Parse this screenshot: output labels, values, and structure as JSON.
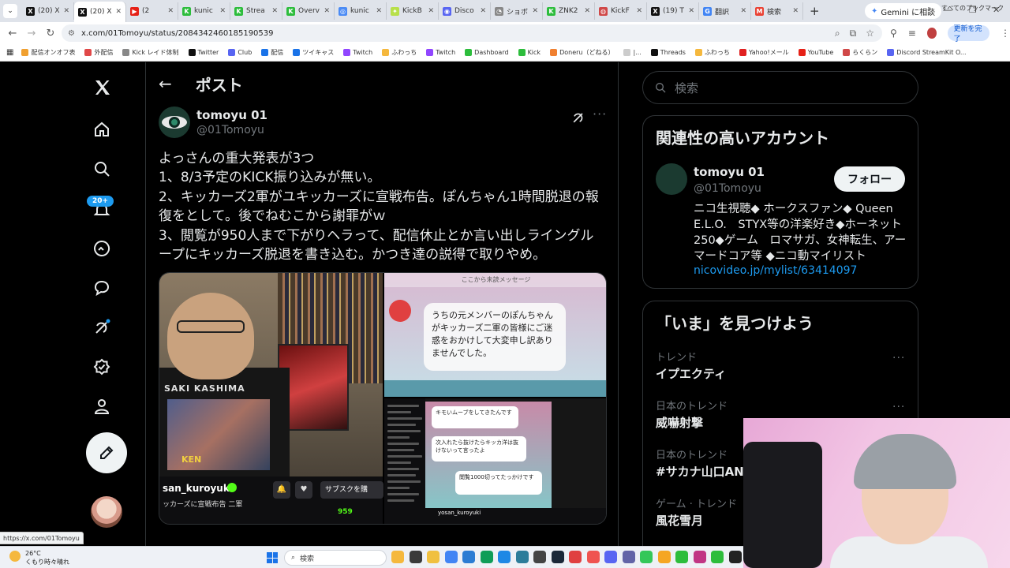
{
  "browser": {
    "tabs": [
      {
        "label": "(20) X",
        "color": "#111111",
        "glyph": "X"
      },
      {
        "label": "(20) X",
        "color": "#111111",
        "glyph": "X",
        "active": true
      },
      {
        "label": "(2",
        "color": "#e62117",
        "glyph": "▶"
      },
      {
        "label": "kunic",
        "color": "#2dbd3c",
        "glyph": "K"
      },
      {
        "label": "Strea",
        "color": "#2dbd3c",
        "glyph": "K"
      },
      {
        "label": "Overv",
        "color": "#2dbd3c",
        "glyph": "K"
      },
      {
        "label": "kunic",
        "color": "#4b8bf5",
        "glyph": "◎"
      },
      {
        "label": "KickB",
        "color": "#b8e04a",
        "glyph": "✦"
      },
      {
        "label": "Disco",
        "color": "#5865f2",
        "glyph": "◉"
      },
      {
        "label": "ショボ",
        "color": "#888888",
        "glyph": "◔"
      },
      {
        "label": "ZNK2",
        "color": "#2dbd3c",
        "glyph": "K"
      },
      {
        "label": "KickF",
        "color": "#d04848",
        "glyph": "◍"
      },
      {
        "label": "(19) T",
        "color": "#111111",
        "glyph": "X"
      },
      {
        "label": "翻訳",
        "color": "#4285f4",
        "glyph": "G"
      },
      {
        "label": "検索",
        "color": "#ea4335",
        "glyph": "M"
      }
    ],
    "gemini_label": "Gemini に相談",
    "url": "x.com/01Tomoyu/status/2084342460185190539",
    "update_label": "更新を完了",
    "bookmarks": [
      {
        "label": "配信オンオフ表",
        "color": "#f0a030"
      },
      {
        "label": "外配信",
        "color": "#e04848"
      },
      {
        "label": "Kick レイド体制",
        "color": "#888888"
      },
      {
        "label": "Twitter",
        "color": "#111111"
      },
      {
        "label": "Club",
        "color": "#5865f2"
      },
      {
        "label": "配信",
        "color": "#1a73e8"
      },
      {
        "label": "ツイキャス",
        "color": "#1a73e8"
      },
      {
        "label": "Twitch",
        "color": "#9146ff"
      },
      {
        "label": "ふわっち",
        "color": "#f5b83d"
      },
      {
        "label": "Twitch",
        "color": "#9146ff"
      },
      {
        "label": "Dashboard",
        "color": "#2dbd3c"
      },
      {
        "label": "Kick",
        "color": "#2dbd3c"
      },
      {
        "label": "Doneru（どねる）",
        "color": "#f08030"
      },
      {
        "label": "|...",
        "color": "#cccccc"
      },
      {
        "label": "Threads",
        "color": "#111111"
      },
      {
        "label": "ふわっち",
        "color": "#f5b83d"
      },
      {
        "label": "Yahoo!メール",
        "color": "#e02020"
      },
      {
        "label": "YouTube",
        "color": "#e62117"
      },
      {
        "label": "らくらン",
        "color": "#d04848"
      },
      {
        "label": "Discord StreamKit O...",
        "color": "#5865f2"
      }
    ],
    "all_bookmarks": "すべてのブックマーク",
    "status_url": "https://x.com/01Tomoyu"
  },
  "nav": {
    "notifications_badge": "20+"
  },
  "post": {
    "header_title": "ポスト",
    "author_name": "tomoyu 01",
    "author_handle": "@01Tomoyu",
    "text": "よっさんの重大発表が3つ\n1、8/3予定のKICK振り込みが無い。\n2、キッカーズ2軍がユキッカーズに宣戦布告。ぽんちゃん1時間脱退の報復をとして。後でねむこから謝罪がｗ\n3、閲覧が950人まで下がりヘラって、配信休止とか言い出しライングループにキッカーズ脱退を書き込む。かつき達の説得で取りやめ。",
    "media": {
      "shirt_text": "SAKI KASHIMA",
      "shirt_ken": "KEN",
      "streamer_name": "san_kuroyuki",
      "stream_title": "ッカーズに宣戦布告 二軍",
      "subscribe_label": "サブスクを購",
      "viewers": "959",
      "chat_header": "ここから未読メッセージ",
      "chat_bubble": "うちの元メンバーのぽんちゃんがキッカーズ二軍の皆様にご迷惑をおかけして大変申し訳ありませんでした。",
      "mini_bubble_1": "キモいムーブをしてきたんです",
      "mini_bubble_2": "次入れたら抜けたらキッカ洋は抜けないって言ったよ",
      "mini_bubble_3": "閲覧1000切ってたっかけです",
      "mini_bar_name": "yosan_kuroyuki"
    }
  },
  "sidebar": {
    "search_placeholder": "検索",
    "related_title": "関連性の高いアカウント",
    "account_name": "tomoyu 01",
    "account_handle": "@01Tomoyu",
    "follow_label": "フォロー",
    "bio": "ニコ生視聴◆ ホークスファン◆ Queen E.L.O.　STYX等の洋楽好き◆ホーネット250◆ゲーム　ロマサガ、女神転生、アーマードコア等 ◆ニコ動マイリスト",
    "bio_link": "nicovideo.jp/mylist/63414097",
    "trends_title": "「いま」を見つけよう",
    "trends": [
      {
        "category": "トレンド",
        "name": "イプエクティ"
      },
      {
        "category": "日本のトレンド",
        "name": "威嚇射撃"
      },
      {
        "category": "日本のトレンド",
        "name": "#サカナ山口ANN"
      },
      {
        "category": "ゲーム · トレンド",
        "name": "風花雪月"
      }
    ]
  },
  "taskbar": {
    "temperature": "26°C",
    "weather": "くもり時々晴れ",
    "search_label": "検索",
    "apps": [
      "#f5b83d",
      "#3a3a3a",
      "#f0c040",
      "#4285f4",
      "#2b7cd3",
      "#0f9d58",
      "#1e88e5",
      "#2d7d9a",
      "#444444",
      "#1b2838",
      "#e04040",
      "#ef5350",
      "#5865f2",
      "#6264a7",
      "#34c759",
      "#f5a623",
      "#2dbd3c",
      "#c13584",
      "#2dbd3c",
      "#222222"
    ]
  },
  "colors": {
    "accent": "#1d9bf0",
    "kick_green": "#53fc18"
  }
}
